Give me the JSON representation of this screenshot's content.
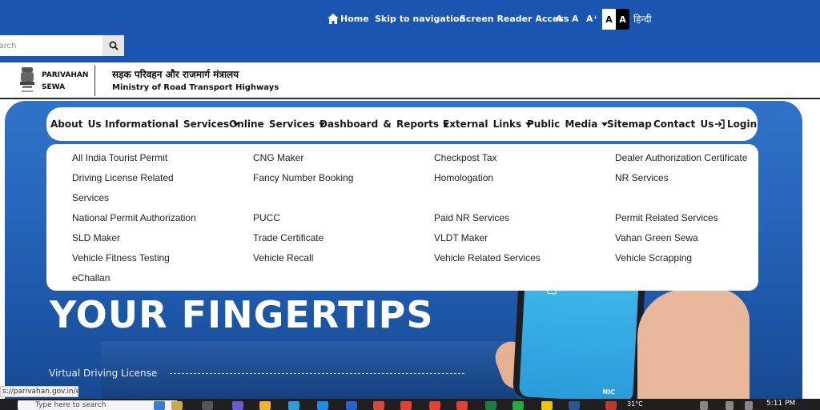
{
  "utility_bar": {
    "home": "Home",
    "skip": "Skip to navigation",
    "screen_reader": "Screen Reader Access",
    "font_decrease": "A⁻",
    "font_normal": "A",
    "font_increase": "A⁺",
    "contrast_light": "A",
    "contrast_dark": "A",
    "language": "हिन्दी"
  },
  "search": {
    "placeholder": "Search"
  },
  "header": {
    "brand_line1": "PARIVAHAN",
    "brand_line2": "SEWA",
    "ministry_hindi": "सड़क परिवहन और राजमार्ग मंत्रालय",
    "ministry_english": "Ministry of Road Transport Highways"
  },
  "nav": {
    "items": [
      {
        "label": "About Us"
      },
      {
        "label": "Informational Services"
      },
      {
        "label": "Online Services"
      },
      {
        "label": "Dashboard & Reports"
      },
      {
        "label": "External Links"
      },
      {
        "label": "Public Media"
      },
      {
        "label": "Sitemap"
      },
      {
        "label": "Contact Us"
      },
      {
        "label": "Login"
      }
    ]
  },
  "dropdown": {
    "col1": [
      "All India Tourist Permit",
      "Driving License Related",
      "Services",
      "National Permit Authorization",
      "SLD Maker",
      "Vehicle Fitness Testing",
      "eChallan"
    ],
    "col2": [
      "CNG Maker",
      "Fancy Number Booking",
      "PUCC",
      "Trade Certificate",
      "Vehicle Recall"
    ],
    "col3": [
      "Checkpost Tax",
      "Homologation",
      "Paid NR Services",
      "VLDT Maker",
      "Vehicle Related Services"
    ],
    "col4": [
      "Dealer Authorization Certificate",
      "NR Services",
      "Permit Related Services",
      "Vahan Green Sewa",
      "Vehicle Scrapping"
    ]
  },
  "hero": {
    "headline": "YOUR FINGERTIPS",
    "subline": "Virtual Driving License",
    "phone_brand": "NIC"
  },
  "status_url": "s://parivahan.gov.in/en",
  "taskbar": {
    "search_placeholder": "Type here to search",
    "temperature": "31°C",
    "time": "5:11 PM"
  }
}
